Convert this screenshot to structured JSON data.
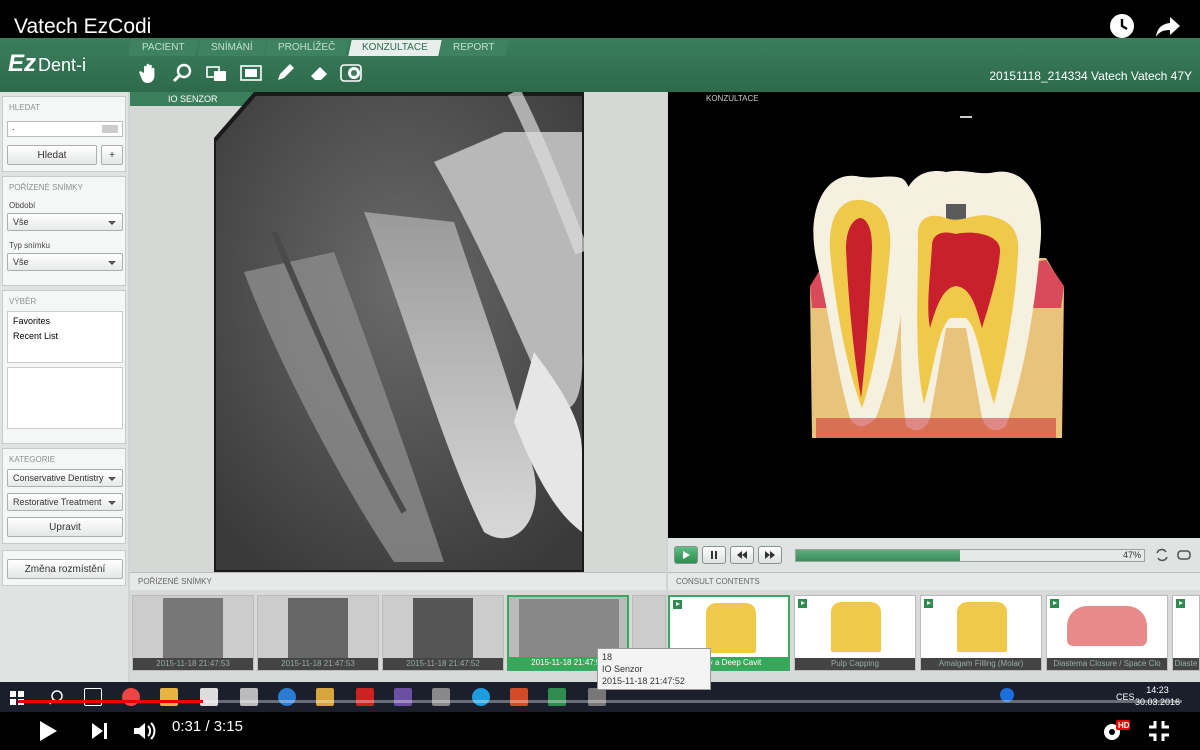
{
  "player": {
    "title": "Vatech EzCodi",
    "time_current": "0:31",
    "time_sep": " / ",
    "time_total": "3:15",
    "progress_fraction": 0.159
  },
  "header": {
    "logo": "Ez",
    "logo_sub": "Dent-i",
    "tabs": [
      "PACIENT",
      "SNÍMÁNÍ",
      "PROHLÍŽEČ",
      "KONZULTACE",
      "REPORT"
    ],
    "active_tab": 3,
    "info": "20151118_214334  Vatech Vatech 47Y"
  },
  "sidebar": {
    "search_title": "HLEDAT",
    "search_value": ".",
    "search_btn": "Hledat",
    "plus_btn": "+",
    "images_title": "POŘÍZENÉ SNÍMKY",
    "period_label": "Období",
    "period_value": "Vše",
    "type_label": "Typ snímku",
    "type_value": "Vše",
    "selection_title": "VÝBĚR",
    "selection_items": [
      "Favorites",
      "Recent List"
    ],
    "category_title": "KATEGORIE",
    "category1": "Conservative Dentistry",
    "category2": "Restorative Treatment",
    "edit_btn": "Upravit",
    "layout_btn": "Změna rozmístění"
  },
  "viewer": {
    "tag": "IO SENZOR"
  },
  "consult": {
    "tag": "KONZULTACE",
    "progress_pct": 0.47,
    "progress_label": "47%"
  },
  "strip_left": {
    "title": "POŘÍZENÉ SNÍMKY",
    "captions": [
      "2015-11-18 21:47:53",
      "2015-11-18 21:47:53",
      "2015-11-18 21:47:52",
      "2015-11-18 21:47:52"
    ]
  },
  "strip_right": {
    "title": "CONSULT CONTENTS",
    "captions": [
      "Why a Deep Cavit",
      "Pulp Capping",
      "Amalgam Filling (Molar)",
      "Diastema Closure / Space Clo",
      "Diaste"
    ]
  },
  "tooltip": {
    "line1": "18",
    "line2": "IO Senzor",
    "line3": "2015-11-18 21:47:52"
  },
  "taskbar": {
    "lang": "CES",
    "time": "14:23",
    "date": "30.03.2016"
  },
  "colors": {
    "app_green": "#3a7e5c",
    "highlight": "#35a85a",
    "yt_red": "#e00"
  }
}
